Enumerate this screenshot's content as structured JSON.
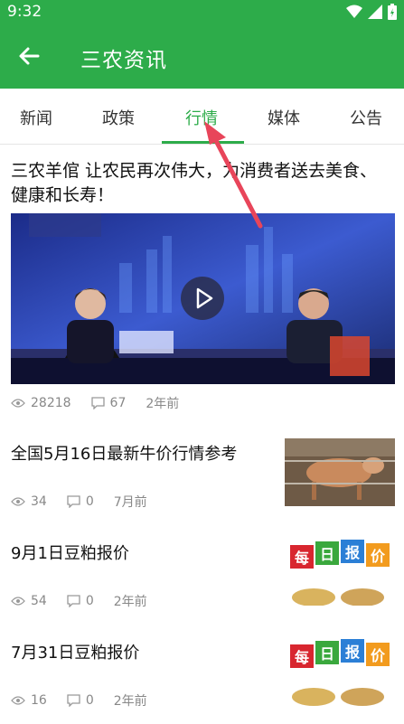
{
  "status": {
    "time": "9:32"
  },
  "appbar": {
    "title": "三农资讯"
  },
  "tabs": [
    {
      "label": "新闻",
      "active": false
    },
    {
      "label": "政策",
      "active": false
    },
    {
      "label": "行情",
      "active": true
    },
    {
      "label": "媒体",
      "active": false
    },
    {
      "label": "公告",
      "active": false
    }
  ],
  "feature": {
    "title": "三农羊倌 让农民再次伟大，为消费者送去美食、健康和长寿！",
    "views": "28218",
    "comments": "67",
    "time": "2年前"
  },
  "items": [
    {
      "title": "全国5月16日最新牛价行情参考",
      "views": "34",
      "comments": "0",
      "time": "7月前"
    },
    {
      "title": "9月1日豆粕报价",
      "views": "54",
      "comments": "0",
      "time": "2年前"
    },
    {
      "title": "7月31日豆粕报价",
      "views": "16",
      "comments": "0",
      "time": "2年前"
    }
  ],
  "thumb_text": {
    "a": "每",
    "b": "日",
    "c": "报",
    "d": "价"
  },
  "colors": {
    "brand": "#2dac4a",
    "arrow": "#e8455a"
  }
}
